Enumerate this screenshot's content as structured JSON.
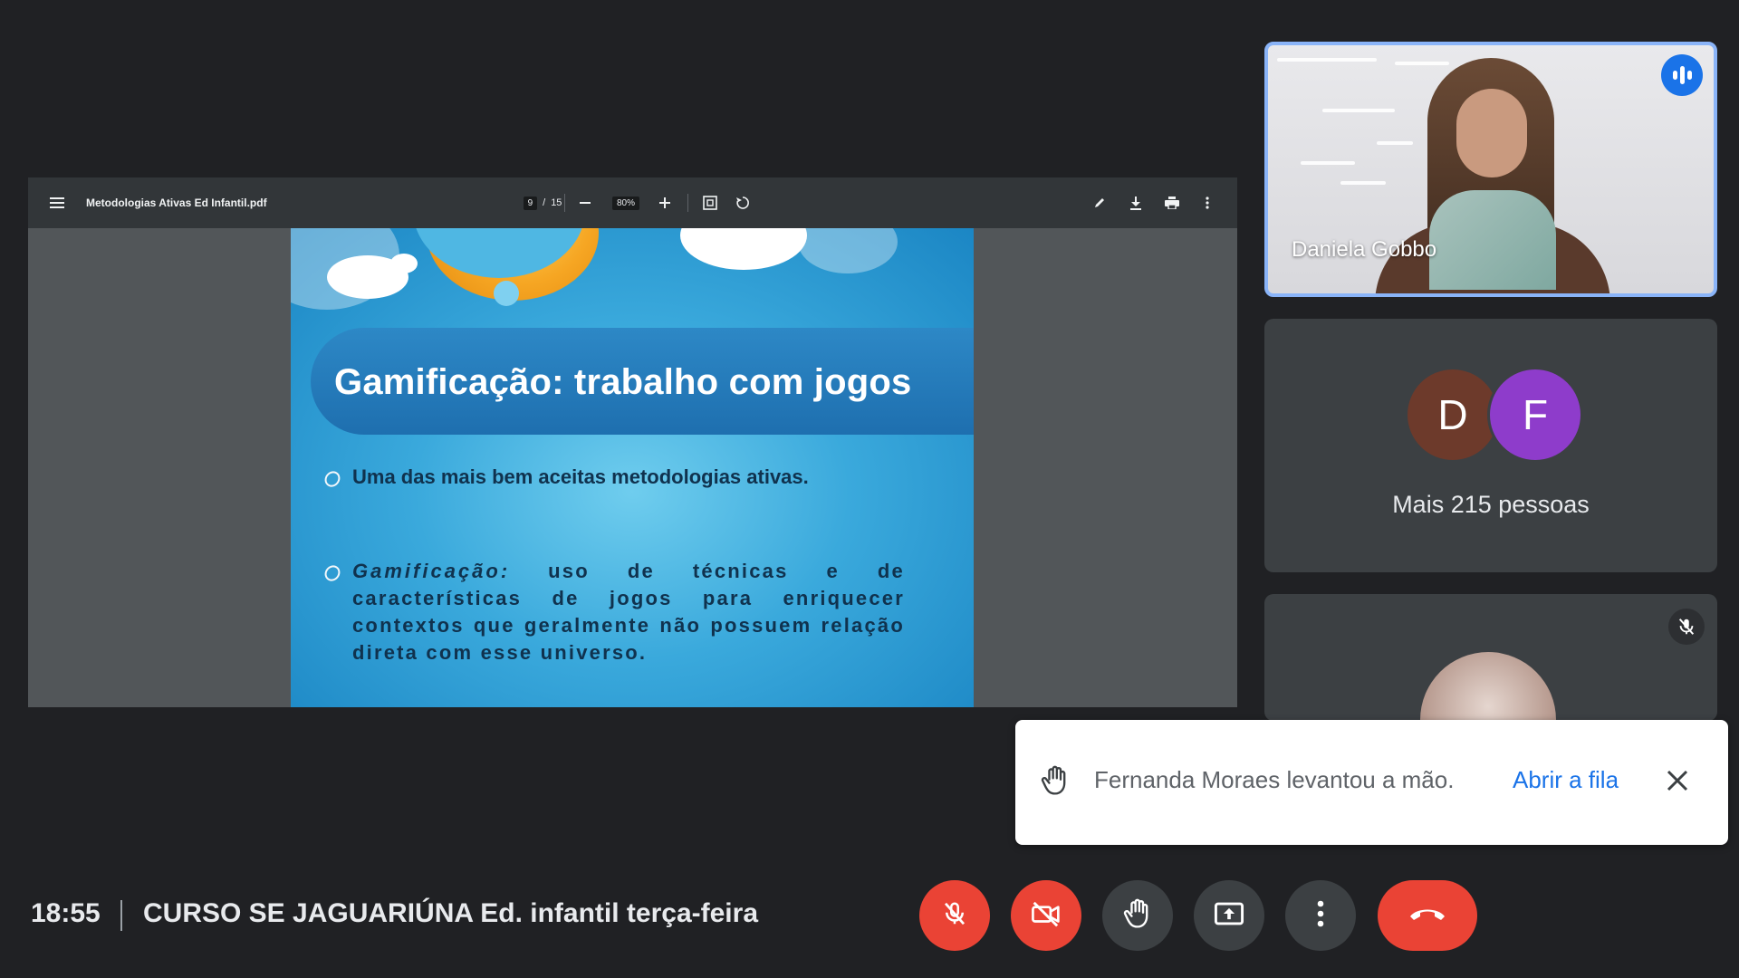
{
  "pdf_viewer": {
    "file_name": "Metodologias Ativas Ed Infantil.pdf",
    "page_current": "9",
    "page_separator": "/",
    "page_total": "15",
    "zoom": "80%",
    "icons": [
      "menu-icon",
      "zoom-out-icon",
      "zoom-in-icon",
      "fit-page-icon",
      "rotate-icon",
      "pen-icon",
      "download-icon",
      "print-icon",
      "more-vert-icon"
    ]
  },
  "slide": {
    "title": "Gamificação: trabalho com jogos",
    "bullet_1": "Uma das mais bem aceitas metodologias ativas.",
    "bullet_2_term": "Gamificação:",
    "bullet_2_text": " uso de técnicas e de características de jogos para enriquecer contextos que geralmente não possuem relação direta com esse universo."
  },
  "participants": {
    "speaker_name": "Daniela Gobbo",
    "avatar_1_initial": "D",
    "avatar_2_initial": "F",
    "more_people": "Mais 215 pessoas",
    "colors": {
      "avatar_d": "#6d3a2b",
      "avatar_f": "#8e3ccb",
      "speaker_border": "#8ab4f8"
    }
  },
  "notification": {
    "message": "Fernanda Moraes levantou a mão.",
    "action": "Abrir a fila",
    "icon": "raised-hand-icon"
  },
  "bottom_bar": {
    "time": "18:55",
    "meeting_title": "CURSO SE JAGUARIÚNA Ed. infantil terça-feira",
    "controls": [
      "mic-off-icon",
      "camera-off-icon",
      "raise-hand-icon",
      "present-screen-icon",
      "more-options-icon",
      "end-call-icon"
    ],
    "colors": {
      "danger": "#ea4335",
      "neutral": "#3c4043",
      "accent": "#1a73e8"
    }
  }
}
